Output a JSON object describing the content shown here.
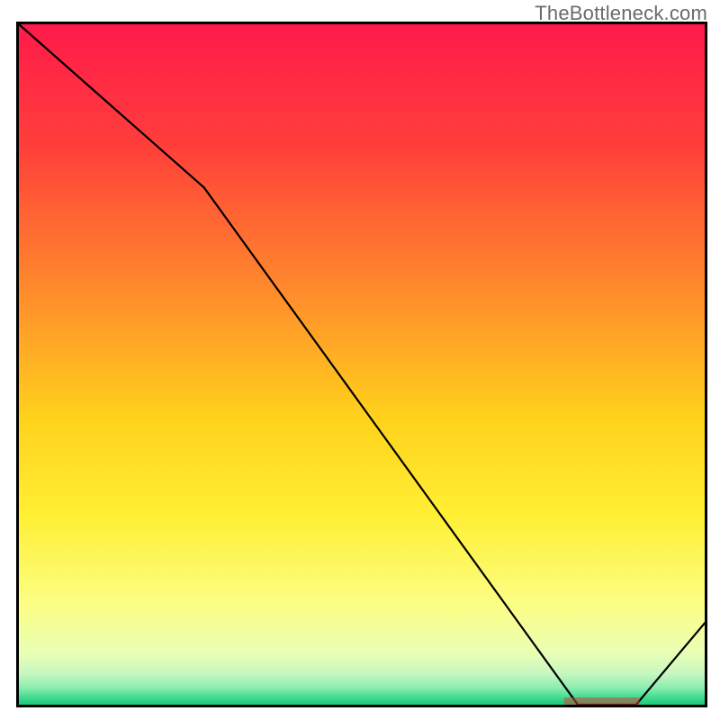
{
  "watermark": "TheBottleneck.com",
  "chart_data": {
    "type": "line",
    "x": [
      0.0,
      0.27,
      0.815,
      0.9,
      1.0
    ],
    "values": [
      1.0,
      0.76,
      0.0,
      0.0,
      0.12
    ],
    "title": "",
    "xlabel": "",
    "ylabel": "",
    "xlim": [
      0,
      1
    ],
    "ylim": [
      0,
      1
    ],
    "note": "Axes have no tick labels; values are normalized 0–1 estimates from the figure.",
    "gradient_stops": [
      {
        "offset": 0.0,
        "color": "#ff1a4b"
      },
      {
        "offset": 0.18,
        "color": "#ff3f3a"
      },
      {
        "offset": 0.4,
        "color": "#ff8e2b"
      },
      {
        "offset": 0.58,
        "color": "#ffd21c"
      },
      {
        "offset": 0.72,
        "color": "#ffef33"
      },
      {
        "offset": 0.86,
        "color": "#fbff89"
      },
      {
        "offset": 0.925,
        "color": "#e8ffb5"
      },
      {
        "offset": 0.955,
        "color": "#c6f7c0"
      },
      {
        "offset": 0.975,
        "color": "#8bedb1"
      },
      {
        "offset": 0.99,
        "color": "#3fd98e"
      },
      {
        "offset": 1.0,
        "color": "#1cc97c"
      }
    ],
    "marker_label": {
      "x": 0.85,
      "y": 0.004,
      "text": "",
      "color": "#c9463d"
    }
  },
  "plot": {
    "outer_x": 18,
    "outer_y": 24,
    "outer_w": 768,
    "outer_h": 762,
    "border_color": "#000000",
    "border_width": 3
  }
}
